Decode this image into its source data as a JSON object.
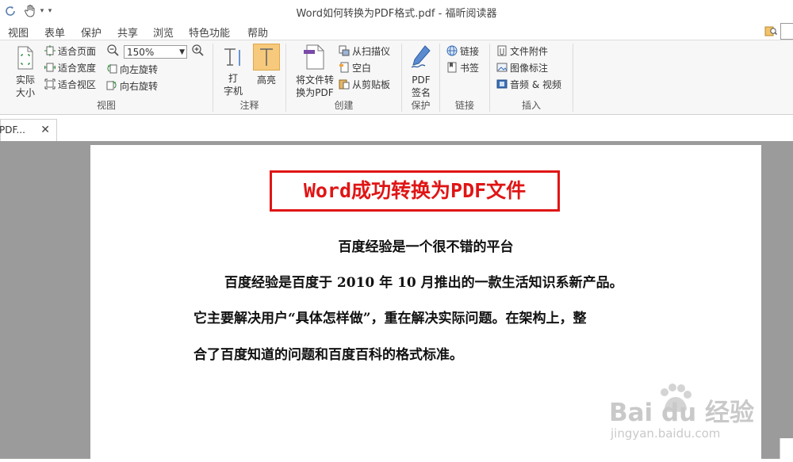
{
  "window": {
    "title": "Word如何转换为PDF格式.pdf - 福昕阅读器"
  },
  "menu": [
    "视图",
    "表单",
    "保护",
    "共享",
    "浏览",
    "特色功能",
    "帮助"
  ],
  "ribbon": {
    "view": {
      "label": "视图",
      "actual_size": [
        "实际",
        "大小"
      ],
      "fit_page": "适合页面",
      "fit_width": "适合宽度",
      "fit_view": "适合视区",
      "zoom": "150%",
      "rotate_left": "向左旋转",
      "rotate_right": "向右旋转"
    },
    "comment": {
      "label": "注释",
      "typewriter": [
        "打",
        "字机"
      ],
      "highlight": "高亮"
    },
    "create": {
      "label": "创建",
      "convert": [
        "将文件转",
        "换为PDF"
      ],
      "from_scanner": "从扫描仪",
      "blank": "空白",
      "from_clipboard": "从剪贴板"
    },
    "protect": {
      "label": "保护",
      "sign": [
        "PDF",
        "签名"
      ]
    },
    "links": {
      "label": "链接",
      "link": "链接",
      "bookmark": "书签"
    },
    "insert": {
      "label": "插入",
      "attachment": "文件附件",
      "image": "图像标注",
      "media": "音频 & 视频"
    }
  },
  "tab": {
    "label": "PDF...",
    "close": "✕"
  },
  "document": {
    "title": "Word成功转换为PDF文件",
    "subtitle": "百度经验是一个很不错的平台",
    "lines": [
      "百度经验是百度于 2010 年 10 月推出的一款生活知识系新产品。",
      "它主要解决用户“具体怎样做”，重在解决实际问题。在架构上，整",
      "合了百度知道的问题和百度百科的格式标准。"
    ]
  },
  "watermark": {
    "brand": "Bai du 经验",
    "url": "jingyan.baidu.com"
  },
  "colors": {
    "title_red": "#e01515",
    "workspace": "#9b9b9b",
    "ribbon": "#f7f7f7"
  }
}
